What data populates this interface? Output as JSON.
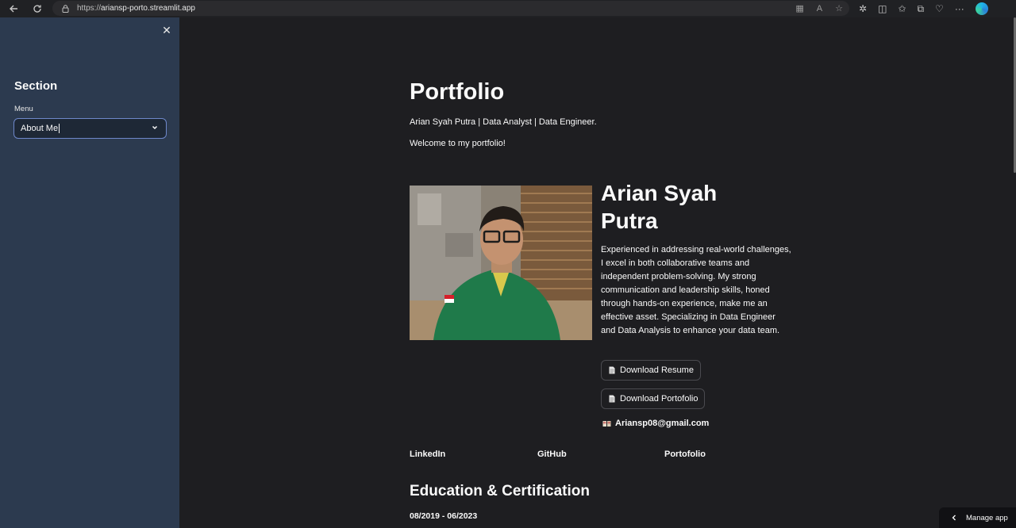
{
  "browser": {
    "url_prefix": "https://",
    "url_host": "ariansp-porto.streamlit.app"
  },
  "sidebar": {
    "section_title": "Section",
    "menu_label": "Menu",
    "menu_selected": "About Me"
  },
  "main": {
    "title": "Portfolio",
    "subtitle": "Arian Syah Putra | Data Analyst | Data Engineer.",
    "welcome": "Welcome to my portfolio!",
    "name_line1": "Arian Syah",
    "name_line2": "Putra",
    "bio": "Experienced in addressing real-world challenges, I excel in both collaborative teams and independent problem-solving. My strong communication and leadership skills, honed through hands-on experience, make me an effective asset. Specializing in Data Engineer and Data Analysis to enhance your data team.",
    "download_resume": "Download Resume",
    "download_portofolio": "Download Portofolio",
    "email": "Ariansp08@gmail.com",
    "links": [
      "LinkedIn",
      "GitHub",
      "Portofolio"
    ],
    "education_title": "Education & Certification",
    "education_date": "08/2019 - 06/2023"
  },
  "footer": {
    "manage_app": "Manage app"
  }
}
